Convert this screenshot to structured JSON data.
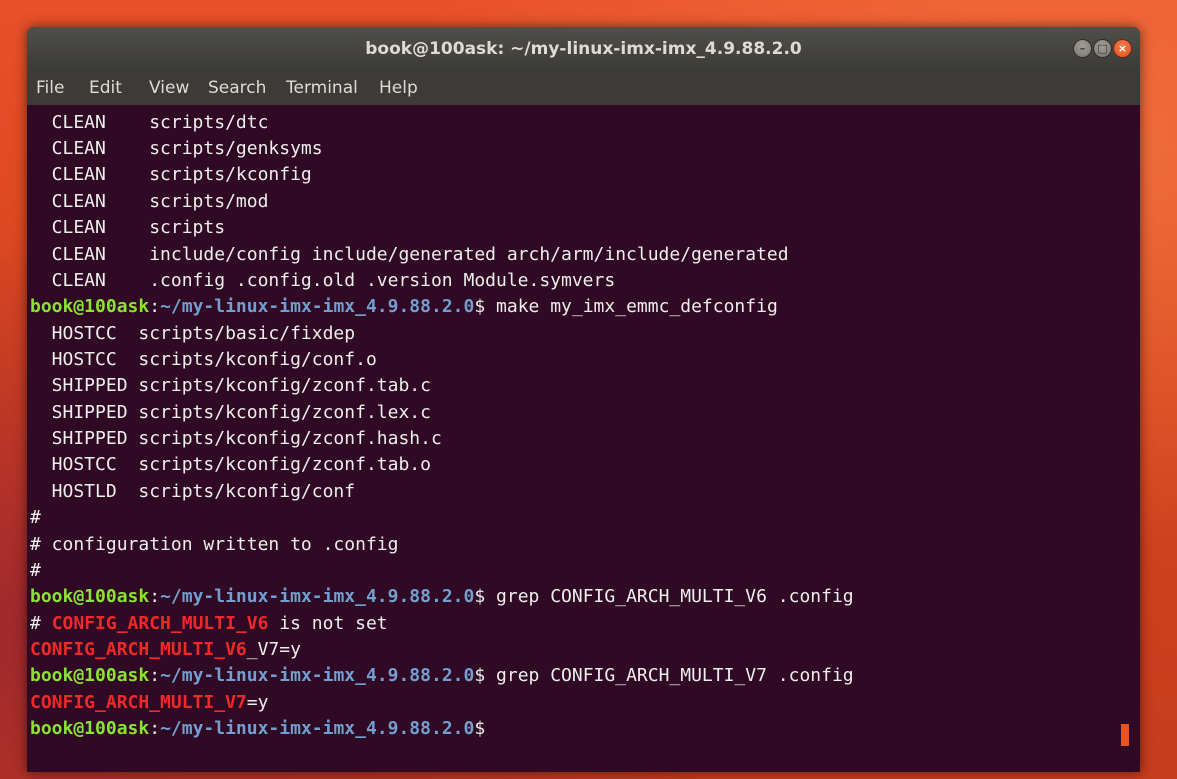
{
  "window": {
    "title": "book@100ask: ~/my-linux-imx-imx_4.9.88.2.0",
    "controls": [
      "minimize-icon",
      "maximize-icon",
      "close-icon"
    ]
  },
  "menu": [
    "File",
    "Edit",
    "View",
    "Search",
    "Terminal",
    "Help"
  ],
  "prompt": {
    "user": "book@100ask",
    "path": "~/my-linux-imx-imx_4.9.88.2.0",
    "suffix": "$"
  },
  "lines": [
    "  CLEAN    scripts/dtc",
    "  CLEAN    scripts/genksyms",
    "  CLEAN    scripts/kconfig",
    "  CLEAN    scripts/mod",
    "  CLEAN    scripts",
    "  CLEAN    include/config include/generated arch/arm/include/generated",
    "  CLEAN    .config .config.old .version Module.symvers",
    " make my_imx_emmc_defconfig",
    "  HOSTCC  scripts/basic/fixdep",
    "  HOSTCC  scripts/kconfig/conf.o",
    "  SHIPPED scripts/kconfig/zconf.tab.c",
    "  SHIPPED scripts/kconfig/zconf.lex.c",
    "  SHIPPED scripts/kconfig/zconf.hash.c",
    "  HOSTCC  scripts/kconfig/zconf.tab.o",
    "  HOSTLD  scripts/kconfig/conf",
    "#",
    "# configuration written to .config",
    "#",
    " grep CONFIG_ARCH_MULTI_V6 .config",
    "# ",
    "CONFIG_ARCH_MULTI_V6",
    " is not set",
    "_V7=y",
    " grep CONFIG_ARCH_MULTI_V7 .config",
    "CONFIG_ARCH_MULTI_V7",
    "=y"
  ],
  "colors": {
    "background": "#300a24",
    "user": "#8ae234",
    "path": "#729fcf",
    "highlight": "#ef2929",
    "cursor": "#e95420"
  }
}
